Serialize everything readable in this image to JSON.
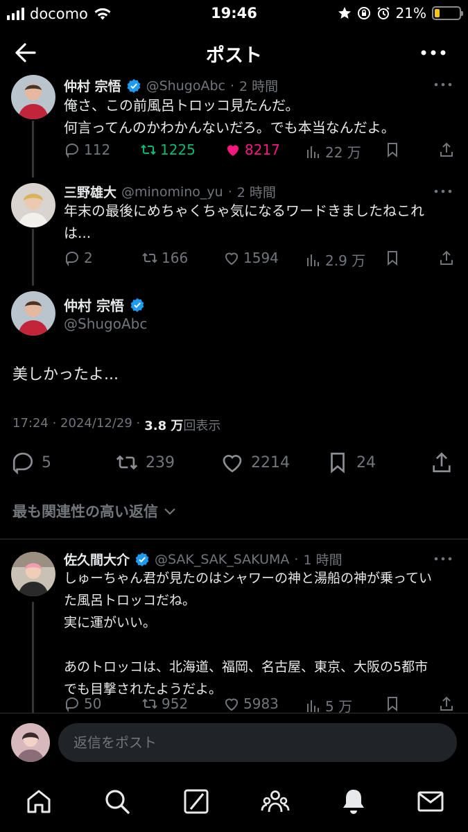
{
  "status_bar": {
    "carrier": "docomo",
    "time": "19:46",
    "battery": "21%",
    "battery_level": 0.21
  },
  "nav": {
    "title": "ポスト",
    "back_icon": "arrow-left-icon",
    "more_icon": "more-horizontal-icon"
  },
  "parent_post": {
    "name": "仲村 宗悟",
    "handle": "@ShugoAbc",
    "time": "2 時間",
    "text": "俺さ、この前風呂トロッコ見たんだ。\n何言ってんのかわかんないだろ。でも本当なんだよ。",
    "replies": "112",
    "reposts": "1225",
    "likes": "8217",
    "views": "22 万"
  },
  "reply_post_1": {
    "name": "三野雄大",
    "handle": "@minomino_yu",
    "time": "2 時間",
    "text": "年末の最後にめちゃくちゃ気になるワードきましたねこれ\nは...",
    "replies": "2",
    "reposts": "166",
    "likes": "1594",
    "views": "2.9 万"
  },
  "main_post": {
    "name": "仲村 宗悟",
    "handle": "@ShugoAbc",
    "text": "美しかったよ...",
    "timestamp": "17:24 · 2024/12/29 ·",
    "views_count": "3.8 万",
    "views_label": "回表示",
    "replies": "5",
    "reposts": "239",
    "likes": "2214",
    "bookmarks": "24"
  },
  "sort_label": "最も関連性の高い返信",
  "reply_post_2": {
    "name": "佐久間大介",
    "handle": "@SAK_SAK_SAKUMA",
    "time": "1 時間",
    "text": "しゅーちゃん君が見たのはシャワーの神と湯船の神が乗ってい\nた風呂トロッコだね。\n実に運がいい。\n\nあのトロッコは、北海道、福岡、名古屋、東京、大阪の5都市\nでも目撃されたようだよ。",
    "replies": "50",
    "reposts": "952",
    "likes": "5983",
    "views": "5 万"
  },
  "reply_input": {
    "placeholder": "返信をポスト"
  },
  "colors": {
    "background": "#000000",
    "text": "#e7e9ea",
    "muted": "#71767b",
    "verified": "#1d9bf0",
    "repost_active": "#00ba7c",
    "like_active": "#f91880"
  },
  "tabs": [
    "home-icon",
    "search-icon",
    "grok-icon",
    "communities-icon",
    "notifications-icon",
    "messages-icon"
  ]
}
